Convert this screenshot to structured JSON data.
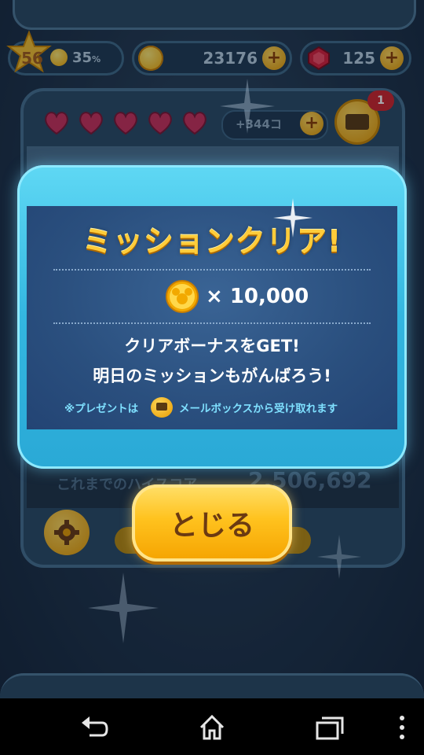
{
  "status": {
    "level": "56",
    "level_progress": "35",
    "level_progress_unit": "%",
    "coins": "23176",
    "gems": "125",
    "plus_symbol": "+"
  },
  "hearts": {
    "count": 5,
    "bonus_text": "+344コ",
    "mail_badge": "1"
  },
  "background": {
    "highscore_label": "これまでのハイスコア",
    "highscore_value": "2,506,692"
  },
  "modal": {
    "title": "ミッションクリア!",
    "reward_amount": "× 10,000",
    "message_line1": "クリアボーナスをGET!",
    "message_line2": "明日のミッションもがんばろう!",
    "note_prefix": "※プレゼントは",
    "note_suffix": "メールボックスから受け取れます",
    "close_label": "とじる"
  },
  "colors": {
    "modal_frame": "#33b6e0",
    "modal_body": "#2a4f7e",
    "title_gold": "#ffcc3a",
    "note_cyan": "#7fe0ff",
    "close_button": "#ffc21e"
  },
  "icons": {
    "coin": "mickey-coin-icon",
    "gem": "ruby-gem-icon",
    "mail": "envelope-icon",
    "settings": "gear-icon",
    "nav_back": "back-arrow-icon",
    "nav_home": "home-icon",
    "nav_recents": "recent-apps-icon",
    "nav_menu": "overflow-menu-icon"
  }
}
